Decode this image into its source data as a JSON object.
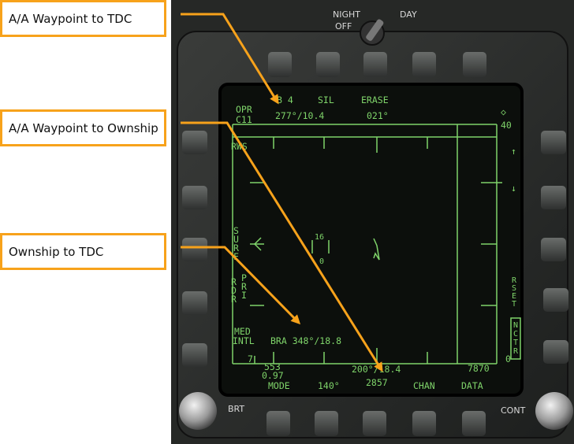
{
  "callouts": [
    {
      "text": "A/A Waypoint to TDC"
    },
    {
      "text": "A/A Waypoint to Ownship"
    },
    {
      "text": "Ownship to TDC"
    }
  ],
  "bezel": {
    "night_day_label": "NIGHT",
    "day_label": "DAY",
    "off_label": "OFF",
    "brt_label": "BRT",
    "cont_label": "CONT"
  },
  "display": {
    "top_row": {
      "opr": "OPR",
      "c11": "C11",
      "b4": "B 4",
      "sil": "SIL",
      "erase": "ERASE",
      "wp_tdc": "277°/10.4",
      "heading": "021°"
    },
    "right_top": {
      "diamond": "◇",
      "value": "40",
      "up_arrow": "↑",
      "down_arrow": "↓"
    },
    "left_side": {
      "rws": "RWS",
      "surf": [
        "S",
        "U",
        "R",
        "F"
      ],
      "rdr": [
        "R",
        "D",
        "R"
      ],
      "pri": [
        "P",
        "R",
        "I"
      ],
      "med": "MED",
      "intl": "INTL",
      "seven": "7"
    },
    "right_side": {
      "rset": [
        "R",
        "S",
        "E",
        "T"
      ],
      "nctr": [
        "N",
        "C",
        "T",
        "R"
      ],
      "zero": "0"
    },
    "center": {
      "target_number": "16",
      "target_sub": "0"
    },
    "bra": "BRA 348°/18.8",
    "bottom": {
      "alt_top": "553",
      "alt_bottom": "0.97",
      "wp_ownship": "200°/18.4",
      "range_right": "7870",
      "mode": "MODE",
      "heading": "140°",
      "speed": "2857",
      "chan": "CHAN",
      "data": "DATA"
    }
  },
  "colors": {
    "accent": "#f7a21b",
    "display_green": "#7fd46a",
    "screen": "#0c0f0c",
    "bezel": "#2a2c2b"
  }
}
